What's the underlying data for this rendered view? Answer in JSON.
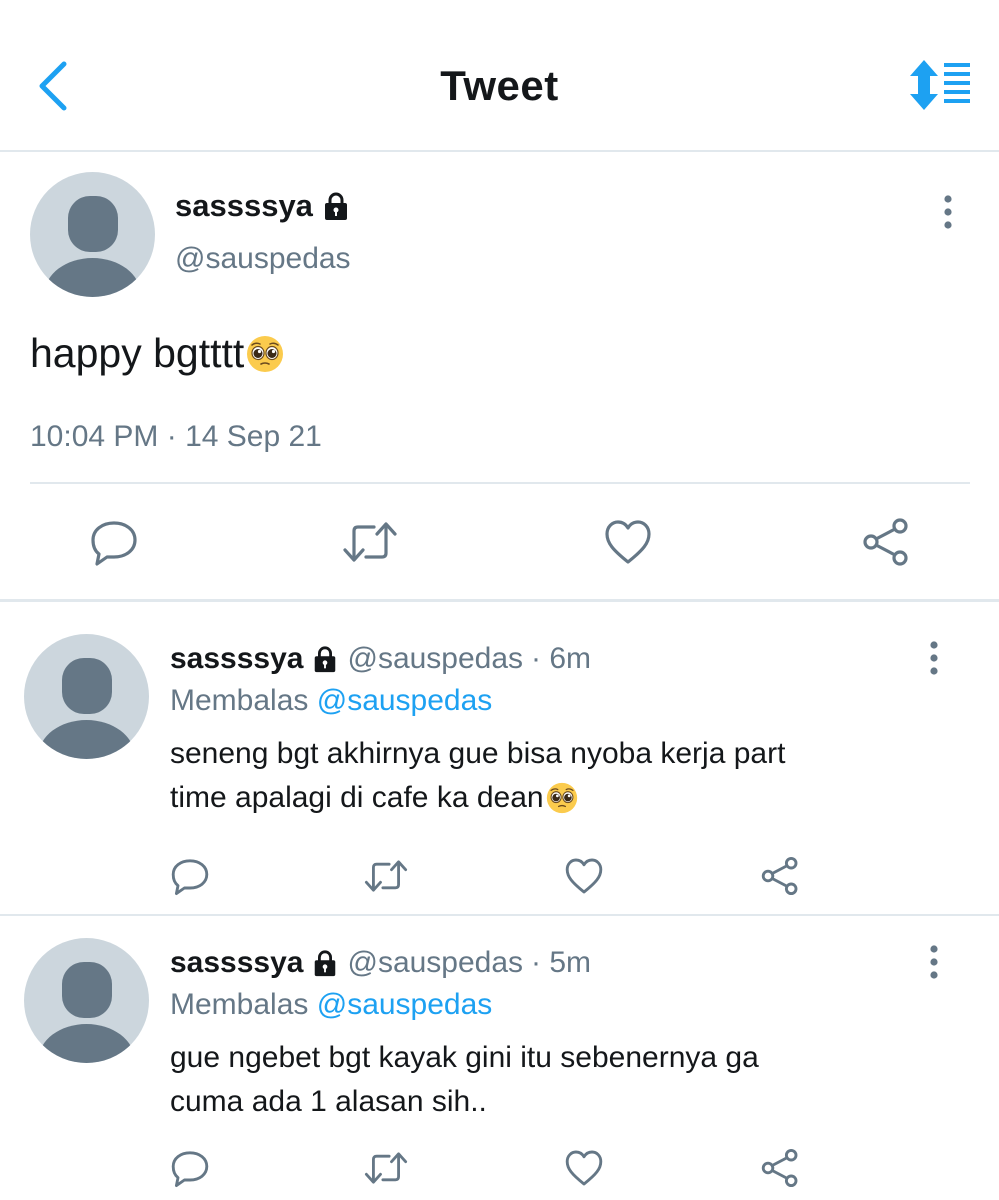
{
  "header": {
    "title": "Tweet",
    "accent_color": "#1da1f2",
    "back_icon": "chevron-left-icon",
    "sort_icon": "sort-timeline-icon"
  },
  "main_tweet": {
    "display_name": "sassssya",
    "handle": "@sauspedas",
    "text": "happy bgtttt",
    "emoji": "pleading-face-emoji",
    "timestamp": "10:04 PM · 14 Sep 21",
    "protected_icon": "lock-icon"
  },
  "replies": [
    {
      "display_name": "sassssya",
      "handle": "@sauspedas",
      "age": "· 6m",
      "replying_label": "Membalas",
      "replying_to": "@sauspedas",
      "text_lines": [
        "seneng bgt akhirnya gue bisa nyoba kerja part",
        "time apalagi di cafe ka dean"
      ],
      "emoji": "pleading-face-emoji"
    },
    {
      "display_name": "sassssya",
      "handle": "@sauspedas",
      "age": "· 5m",
      "replying_label": "Membalas",
      "replying_to": "@sauspedas",
      "text_lines": [
        "gue ngebet bgt kayak gini itu sebenernya ga",
        "cuma ada 1 alasan sih.."
      ]
    }
  ],
  "actions": [
    "reply-icon",
    "retweet-icon",
    "like-icon",
    "share-icon"
  ],
  "colors": {
    "text": "#14171a",
    "secondary": "#657786",
    "divider": "#e1e8ed",
    "avatar_bg": "#ccd6dd",
    "avatar_fg": "#657786"
  }
}
